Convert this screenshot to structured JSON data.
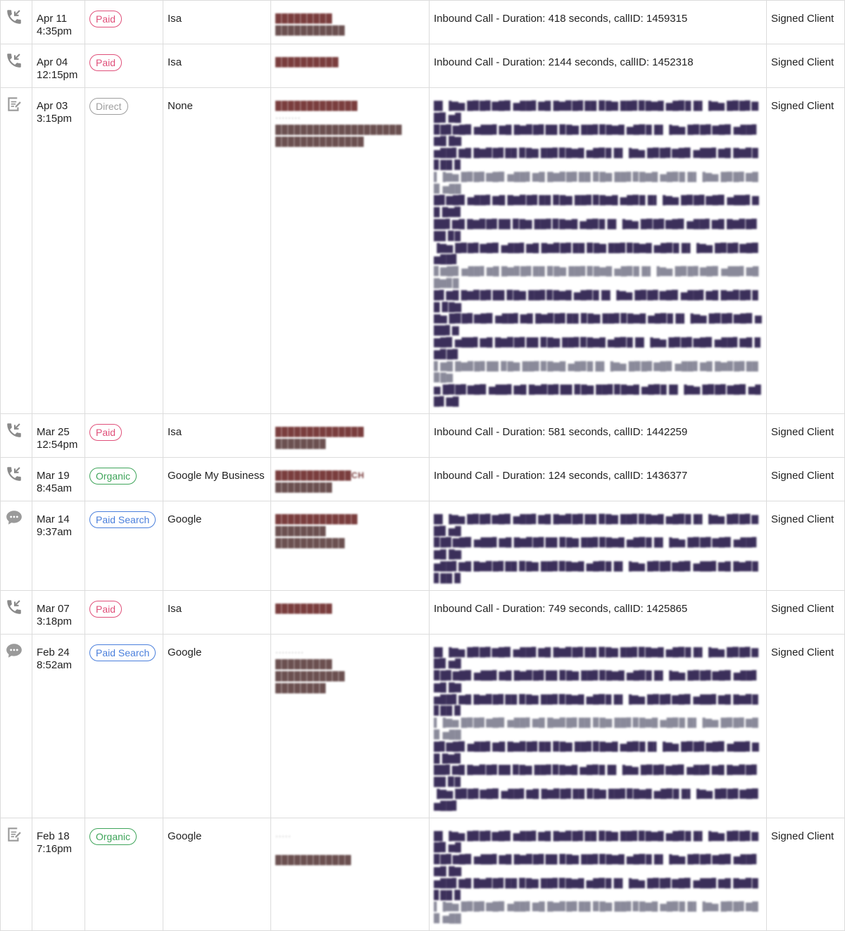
{
  "colors": {
    "paid": "#e0507a",
    "direct": "#9e9e9e",
    "organic": "#3fa55a",
    "paid_search": "#4a7fdc",
    "icon": "#8a8a8a"
  },
  "rows": [
    {
      "icon": "phone-incoming-icon",
      "date": "Apr 11",
      "time": "4:35pm",
      "source": "Paid",
      "source_kind": "paid",
      "channel": "Isa",
      "contact": [
        "█████████",
        "███████████"
      ],
      "details": "Inbound Call - Duration: 418 seconds, callID: 1459315",
      "details_blurred": false,
      "status": "Signed Client"
    },
    {
      "icon": "phone-incoming-icon",
      "date": "Apr 04",
      "time": "12:15pm",
      "source": "Paid",
      "source_kind": "paid",
      "channel": "Isa",
      "contact": [
        "██████████"
      ],
      "details": "Inbound Call - Duration: 2144 seconds, callID: 1452318",
      "details_blurred": false,
      "status": "Signed Client"
    },
    {
      "icon": "form-edit-icon",
      "date": "Apr 03",
      "time": "3:15pm",
      "source": "Direct",
      "source_kind": "direct",
      "channel": "None",
      "contact": [
        "█████████████",
        "········",
        "████████████████████",
        "██████████████"
      ],
      "details": "",
      "details_blurred": true,
      "details_lines": 13,
      "status": "Signed Client"
    },
    {
      "icon": "phone-incoming-icon",
      "date": "Mar 25",
      "time": "12:54pm",
      "source": "Paid",
      "source_kind": "paid",
      "channel": "Isa",
      "contact": [
        "██████████████",
        "████████"
      ],
      "details": "Inbound Call - Duration: 581 seconds, callID: 1442259",
      "details_blurred": false,
      "status": "Signed Client"
    },
    {
      "icon": "phone-incoming-icon",
      "date": "Mar 19",
      "time": "8:45am",
      "source": "Organic",
      "source_kind": "organic",
      "channel": "Google My Business",
      "contact": [
        "████████████CH",
        "█████████"
      ],
      "details": "Inbound Call - Duration: 124 seconds, callID: 1436377",
      "details_blurred": false,
      "status": "Signed Client"
    },
    {
      "icon": "chat-bubble-icon",
      "date": "Mar 14",
      "time": "9:37am",
      "source": "Paid Search",
      "source_kind": "paid_search",
      "channel": "Google",
      "contact": [
        "█████████████",
        "████████",
        "███████████"
      ],
      "details": "",
      "details_blurred": true,
      "details_lines": 3,
      "status": "Signed Client"
    },
    {
      "icon": "phone-incoming-icon",
      "date": "Mar 07",
      "time": "3:18pm",
      "source": "Paid",
      "source_kind": "paid",
      "channel": "Isa",
      "contact": [
        "█████████"
      ],
      "details": "Inbound Call - Duration: 749 seconds, callID: 1425865",
      "details_blurred": false,
      "status": "Signed Client"
    },
    {
      "icon": "chat-bubble-icon",
      "date": "Feb 24",
      "time": "8:52am",
      "source": "Paid Search",
      "source_kind": "paid_search",
      "channel": "Google",
      "contact": [
        "·········",
        "█████████",
        "███████████",
        "████████"
      ],
      "details": "",
      "details_blurred": true,
      "details_lines": 7,
      "status": "Signed Client"
    },
    {
      "icon": "form-edit-icon",
      "date": "Feb 18",
      "time": "7:16pm",
      "source": "Organic",
      "source_kind": "organic",
      "channel": "Google",
      "contact": [
        "·····",
        "",
        "████████████"
      ],
      "details": "",
      "details_blurred": true,
      "details_lines": 4,
      "status": "Signed Client"
    }
  ]
}
